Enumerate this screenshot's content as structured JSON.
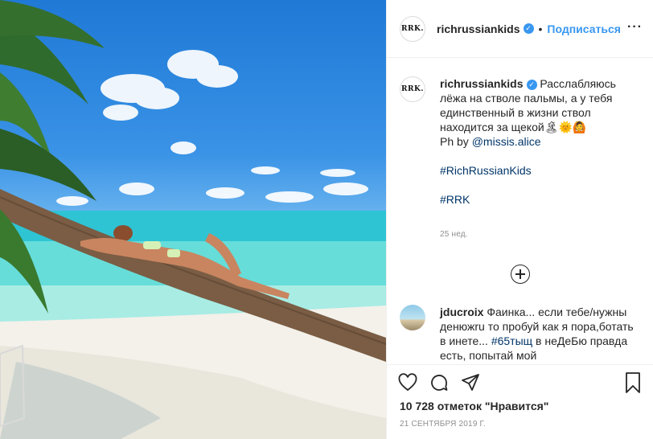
{
  "post": {
    "image_icon": "photo-woman-on-palm-tree",
    "account": {
      "avatar_text": "RRK.",
      "username": "richrussiankids",
      "verified_icon": "verified-badge-icon",
      "separator": "•",
      "follow_label": "Подписаться",
      "more_icon": "more-options-icon",
      "more_text": "···"
    },
    "caption": {
      "avatar_text": "RRK.",
      "username": "richrussiankids",
      "text": "Расслабляюсь лёжа на стволе пальмы, а у тебя единственный в жизни ствол находится за щекой🏝🌞🙆",
      "credit_prefix": "Ph by ",
      "credit_mention": "@missis.alice",
      "hashtag1": "#RichRussianKids",
      "hashtag2": "#RRK",
      "time": "25 нед."
    },
    "load_more_icon": "plus-circle-icon",
    "comments": [
      {
        "username": "jducroix",
        "text": "Фаинка... если тебе/нужны денюжru то пробуй как я пора,ботать в инете...",
        "hashtag": "#65тыщ",
        "tail": " в неДеБю правда есть, попытай мой"
      }
    ],
    "actions": {
      "like_icon": "heart-icon",
      "comment_icon": "comment-icon",
      "share_icon": "share-icon",
      "save_icon": "bookmark-icon"
    },
    "likes": "10 728 отметок \"Нравится\"",
    "date": "21 СЕНТЯБРЯ 2019 Г.",
    "colors": {
      "link": "#3897f0",
      "mention": "#003569",
      "muted": "#8e8e8e"
    }
  }
}
